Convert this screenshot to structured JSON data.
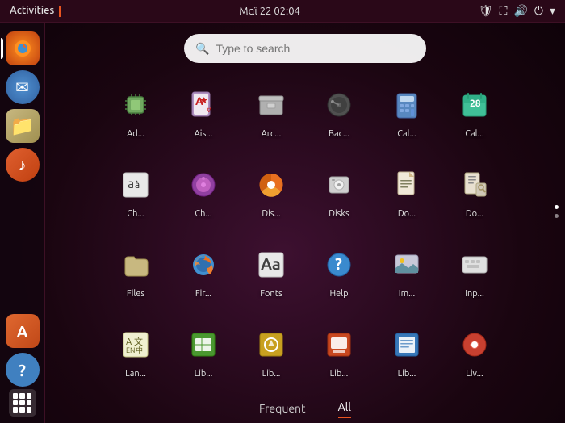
{
  "topbar": {
    "activities": "Activities",
    "datetime": "Μαϊ 22  02:04",
    "icons": [
      "shield",
      "network",
      "volume",
      "power",
      "settings"
    ]
  },
  "search": {
    "placeholder": "Type to search"
  },
  "tabs": [
    {
      "id": "frequent",
      "label": "Frequent",
      "active": false
    },
    {
      "id": "all",
      "label": "All",
      "active": true
    }
  ],
  "apps": [
    {
      "id": "cpu-freq",
      "label": "Ad...",
      "icon": "cpu"
    },
    {
      "id": "aisleriot",
      "label": "Ais...",
      "icon": "aisleriot"
    },
    {
      "id": "archive",
      "label": "Arc...",
      "icon": "archive"
    },
    {
      "id": "backup",
      "label": "Bac...",
      "icon": "backup"
    },
    {
      "id": "calculator",
      "label": "Cal...",
      "icon": "calculator"
    },
    {
      "id": "calendar",
      "label": "Cal...",
      "icon": "calendar"
    },
    {
      "id": "charmap",
      "label": "Ch...",
      "icon": "charmap"
    },
    {
      "id": "cheese",
      "label": "Ch...",
      "icon": "cheese"
    },
    {
      "id": "disk-usage",
      "label": "Dis...",
      "icon": "disk-usage"
    },
    {
      "id": "disks",
      "label": "Disks",
      "icon": "disks"
    },
    {
      "id": "document",
      "label": "Do...",
      "icon": "document"
    },
    {
      "id": "docviewer",
      "label": "Do...",
      "icon": "docviewer"
    },
    {
      "id": "files",
      "label": "Files",
      "icon": "files"
    },
    {
      "id": "firefox",
      "label": "Fir...",
      "icon": "firefox"
    },
    {
      "id": "fonts",
      "label": "Fonts",
      "icon": "fonts"
    },
    {
      "id": "help",
      "label": "Help",
      "icon": "help"
    },
    {
      "id": "imageviewer",
      "label": "Im...",
      "icon": "imageviewer"
    },
    {
      "id": "inputmethod",
      "label": "Inp...",
      "icon": "inputmethod"
    },
    {
      "id": "language",
      "label": "Lan...",
      "icon": "language"
    },
    {
      "id": "librecalc",
      "label": "Lib...",
      "icon": "librecalc"
    },
    {
      "id": "libredraw",
      "label": "Lib...",
      "icon": "libredraw"
    },
    {
      "id": "libreimpress",
      "label": "Lib...",
      "icon": "libreimpress"
    },
    {
      "id": "librewriter",
      "label": "Lib...",
      "icon": "librewriter"
    },
    {
      "id": "livepatch",
      "label": "Liv...",
      "icon": "livepatch"
    }
  ],
  "sidebar": {
    "items": [
      {
        "id": "firefox",
        "emoji": "🦊",
        "color": "#e95420"
      },
      {
        "id": "mail",
        "emoji": "✉",
        "color": "#5090d0"
      },
      {
        "id": "files",
        "emoji": "📁",
        "color": "#c8b880"
      },
      {
        "id": "music",
        "emoji": "🎵",
        "color": "#e06030"
      },
      {
        "id": "appstore",
        "emoji": "A",
        "color": "#e06830"
      },
      {
        "id": "help",
        "emoji": "?",
        "color": "#4080c0"
      }
    ]
  },
  "scroll_dots": [
    {
      "active": true
    },
    {
      "active": false
    }
  ]
}
